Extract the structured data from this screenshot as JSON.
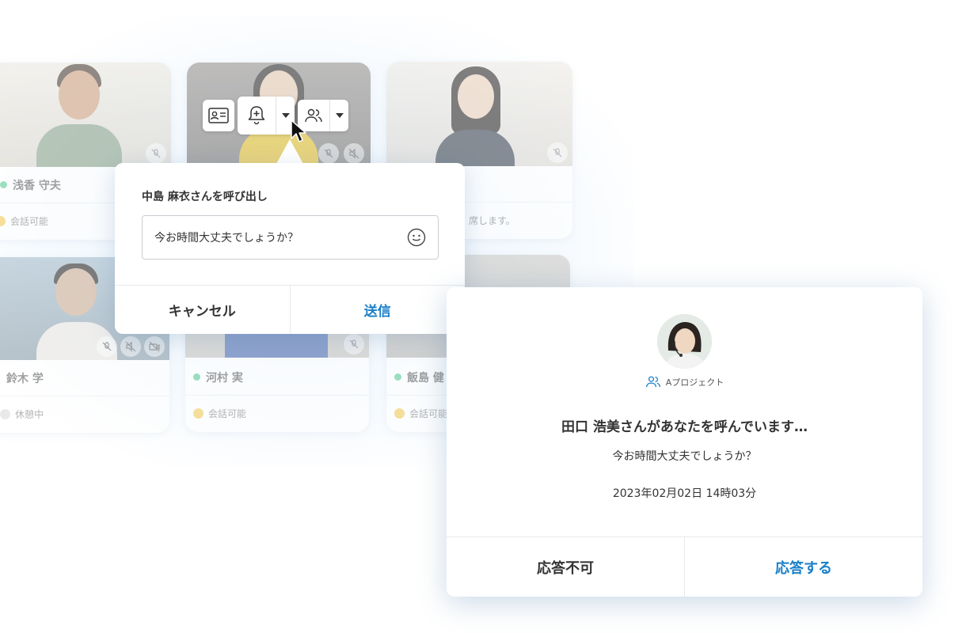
{
  "members": [
    {
      "name": "浅香 守夫",
      "status": "会話可能",
      "status_color": "#4fc98a"
    },
    {
      "name": "",
      "status": "",
      "status_color": "#4fc98a"
    },
    {
      "name": "",
      "status": "席します。",
      "status_color": "#4fc98a"
    },
    {
      "name": "鈴木 学",
      "status": "休憩中",
      "status_color": "#4fc98a"
    },
    {
      "name": "河村 実",
      "status": "会話可能",
      "status_color": "#4fc98a"
    },
    {
      "name": "飯島 健",
      "status": "会話可能",
      "status_color": "#4fc98a"
    }
  ],
  "toolbar": {
    "profile_icon": "id-card-icon",
    "call_icon": "bell-plus-icon",
    "group_icon": "people-icon"
  },
  "call_popup": {
    "title": "中島 麻衣さんを呼び出し",
    "message": "今お時間大丈夫でしょうか？",
    "cancel_label": "キャンセル",
    "send_label": "送信"
  },
  "incoming": {
    "project": "Aプロジェクト",
    "title": "田口 浩美さんがあなたを呼んでいます…",
    "message": "今お時間大丈夫でしょうか？",
    "timestamp": "2023年02月02日 14時03分",
    "decline_label": "応答不可",
    "accept_label": "応答する"
  },
  "colors": {
    "accent": "#1a7fc9",
    "online": "#4fc98a"
  }
}
